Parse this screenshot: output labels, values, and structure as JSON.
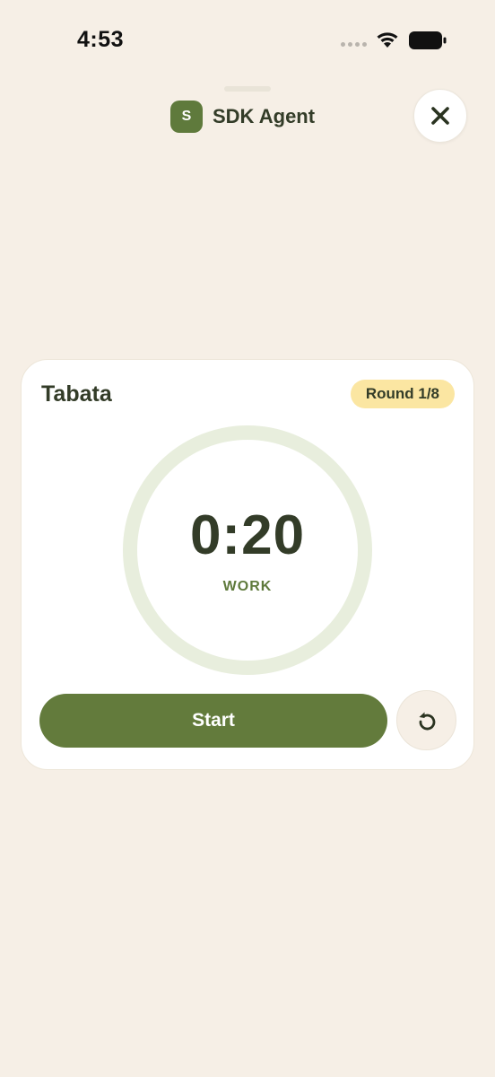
{
  "status_bar": {
    "time": "4:53",
    "signal_icon": "signal-dots-icon",
    "wifi_icon": "wifi-icon",
    "battery_icon": "battery-icon"
  },
  "header": {
    "agent_initial": "S",
    "agent_name": "SDK Agent",
    "close_icon": "close-icon"
  },
  "timer_card": {
    "title": "Tabata",
    "round_label": "Round 1/8",
    "time_remaining": "0:20",
    "phase": "WORK",
    "start_label": "Start",
    "reset_icon": "reset-icon"
  },
  "colors": {
    "background": "#f6efe6",
    "accent": "#637b3c",
    "round_pill": "#fbe6a2",
    "ring": "#e8eedd",
    "text_dark": "#333c28"
  }
}
